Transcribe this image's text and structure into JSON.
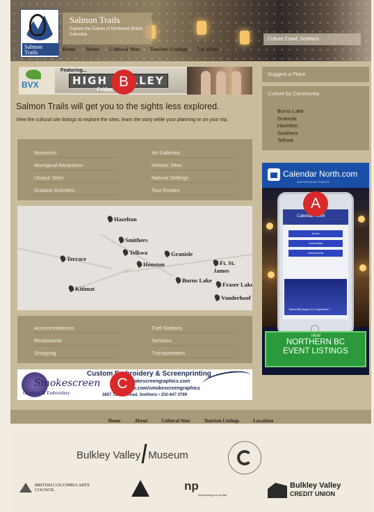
{
  "header": {
    "logo_text": "Salmon Trails",
    "title": "Salmon Trails",
    "subtitle": "Explore the Culture of Northwest British Columbia",
    "caption": "Culture Crawl: Smithers",
    "nav": [
      "Home",
      "About",
      "Cultural Sites",
      "Tourism Listings",
      "Locations"
    ]
  },
  "banner": {
    "logo_text": "BVX",
    "prefix": "Featuring...",
    "headline": "HIGH VALLEY",
    "subline": "Friday, A..."
  },
  "intro": {
    "heading": "Salmon Trails will get you to the sights less explored.",
    "body": "View the cultural site listings to explore the sites, learn the story while your planning or on your trip."
  },
  "categories_left": [
    "Museums",
    "Aboriginal Attractions",
    "Unique Sites",
    "Outdoor Activities"
  ],
  "categories_right": [
    "Art Galleries",
    "Historic Sites",
    "Natural Settings",
    "Tour Routes"
  ],
  "map_places": [
    "Hazelton",
    "Smithers",
    "Telkwa",
    "Terrace",
    "Houston",
    "Granisle",
    "Ft. St. James",
    "Burns Lake",
    "Fraser Lake",
    "Kitimat",
    "Vanderhoof"
  ],
  "services_left": [
    "Accommodations",
    "Restaurants",
    "Shopping"
  ],
  "services_right": [
    "Fuel Stations",
    "Services",
    "Transportation"
  ],
  "ad_smokescreen": {
    "logo": "Smokescreen",
    "tagline": "Graphics & Embroidery",
    "headline": "Custom Embroidery & Screenprinting",
    "url1": "www.smokescreengraphics.com",
    "url2": "facebook.com/smokescreengraphics",
    "address": "3857 Tatlow Road, Smithers • 250-847-3799"
  },
  "sidebar": {
    "suggest": "Suggest a Place",
    "community_heading": "Culture by Community",
    "communities": [
      "Burns Lake",
      "Granisle",
      "Hazelton",
      "Smithers",
      "Telkwa"
    ]
  },
  "calendar_ad": {
    "brand": "Calendar North.com",
    "tagline": "NORTHERN BC EVENTS",
    "app_title": "Calendar North",
    "buttons": [
      "Events",
      "Communities",
      "Submit Events"
    ],
    "event_caption": "Telkwa BBQ August 31 & September 1",
    "cta_small": "VIEW",
    "cta_line1": "NORTHERN BC",
    "cta_line2": "EVENT LISTINGS"
  },
  "footer_nav": [
    "Home",
    "About",
    "Cultural Sites",
    "Tourism Listings",
    "Locations"
  ],
  "footer": {
    "museum_left": "Bulkley Valley",
    "museum_right": "Museum",
    "bc_arts": "BRITISH COLUMBIA ARTS COUNCIL",
    "np": "np",
    "np_tag": "enterprising non-profits",
    "bvcu1": "Bulkley Valley",
    "bvcu2": "CREDIT UNION"
  },
  "markers": {
    "a": "A",
    "b": "B",
    "c": "C"
  }
}
